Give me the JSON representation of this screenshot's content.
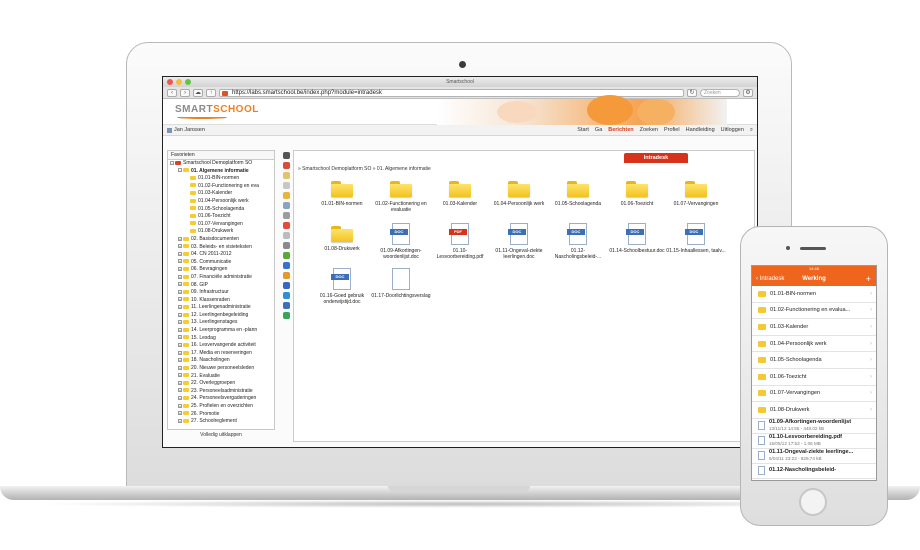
{
  "colors": {
    "accent": "#f0651e",
    "brand_orange": "#f0801f",
    "tab_red": "#d6331a",
    "folder": "#f5c931"
  },
  "browser": {
    "title": "Smartschool",
    "url": "https://labs.smartschool.be/index.php?module=intradesk",
    "search_placeholder": "Zoeken"
  },
  "site": {
    "logo_left": "SMART",
    "logo_right": "SCHOOL"
  },
  "usernav": {
    "user": "Jan Janssen",
    "links": [
      "Start",
      "Ga",
      "Berichten",
      "Zoeken",
      "Profiel",
      "Handleiding",
      "Uitloggen"
    ],
    "active": "Berichten"
  },
  "tree": {
    "select": "Favorieten",
    "footer": "Volledig uitklappen",
    "items": [
      "Smartschool Demoplatform SO",
      "01. Algemene informatie",
      "01.01-BIN-normen",
      "01.02-Functionering en eva",
      "01.03-Kalender",
      "01.04-Persoonlijk werk",
      "01.05-Schoolagenda",
      "01.06-Toezicht",
      "01.07-Vervangingen",
      "01.08-Drukwerk",
      "02. Basisdocumenten",
      "03. Beleids- en visieteksten",
      "04. CN 2011-2012",
      "05. Communicatie",
      "06. Bevragingen",
      "07. Financiële administratie",
      "08. GIP",
      "09. Infrastructuur",
      "10. Klassenraden",
      "11. Leerlingenadministratie",
      "12. Leerlingenbegeleiding",
      "13. Leerlingenstages",
      "14. Leerprogramma en -plann",
      "15. Lesdag",
      "16. Lesvervangende activiteit",
      "17. Media en reserveringen",
      "18. Nascholingen",
      "20. Nieuwe personeelsleden",
      "21. Evaluatie",
      "22. Overleggroepen",
      "23. Personeelsadministratie",
      "24. Personeelsvergaderingen",
      "25. Profielen en overzichten",
      "26. Promotie",
      "27. Schoolreglement"
    ]
  },
  "content": {
    "tab": "Intradesk",
    "breadcrumb": "» Smartschool Demoplatform SO » 01. Algemene informatie",
    "tiles": [
      {
        "label": "01.01-BIN-normen",
        "kind": "folder"
      },
      {
        "label": "01.02-Functionering en evaluatie",
        "kind": "folder"
      },
      {
        "label": "01.03-Kalender",
        "kind": "folder"
      },
      {
        "label": "01.04-Persoonlijk werk",
        "kind": "folder"
      },
      {
        "label": "01.05-Schoolagenda",
        "kind": "folder"
      },
      {
        "label": "01.06-Toezicht",
        "kind": "folder"
      },
      {
        "label": "01.07-Vervangingen",
        "kind": "folder"
      },
      {
        "label": "01.08-Drukwerk",
        "kind": "folder"
      },
      {
        "label": "01.09-Afkortingen-woordenlijst.doc",
        "kind": "doc"
      },
      {
        "label": "01.10-Lesvoorbereiding.pdf",
        "kind": "pdf"
      },
      {
        "label": "01.11-Ongeval-ziekte leerlingen.doc",
        "kind": "doc"
      },
      {
        "label": "01.12-Nascholingsbeleid-...",
        "kind": "doc"
      },
      {
        "label": "01.14-Schoolbestuur.doc",
        "kind": "doc"
      },
      {
        "label": "01.15-Inhaallessen, taalv...",
        "kind": "doc"
      },
      {
        "label": "01.16-Goed gebruik onderwijstijd.doc",
        "kind": "doc"
      },
      {
        "label": "01.17-Doorlichtingsverslag",
        "kind": "file"
      }
    ]
  },
  "phone": {
    "time": "14:48",
    "carrier": "",
    "battery": "",
    "back": "Intradesk",
    "title": "Werking",
    "plus": "+",
    "folders": [
      "01.01-BIN-normen",
      "01.02-Functionering en evalua...",
      "01.03-Kalender",
      "01.04-Persoonlijk werk",
      "01.05-Schoolagenda",
      "01.06-Toezicht",
      "01.07-Vervangingen",
      "01.08-Drukwerk"
    ],
    "files": [
      {
        "name": "01.09-Afkortingen-woordenlijst",
        "meta": "13/11/12 14:55 - 448.02 kB"
      },
      {
        "name": "01.10-Lesvoorbereiding.pdf",
        "meta": "15/05/12 17:53 - 1,06 MB"
      },
      {
        "name": "01.11-Ongeval-ziekte leerlinge...",
        "meta": "5/04/11 23:22 - 829,74 kB"
      },
      {
        "name": "01.12-Nascholingsbeleid-",
        "meta": ""
      }
    ]
  }
}
